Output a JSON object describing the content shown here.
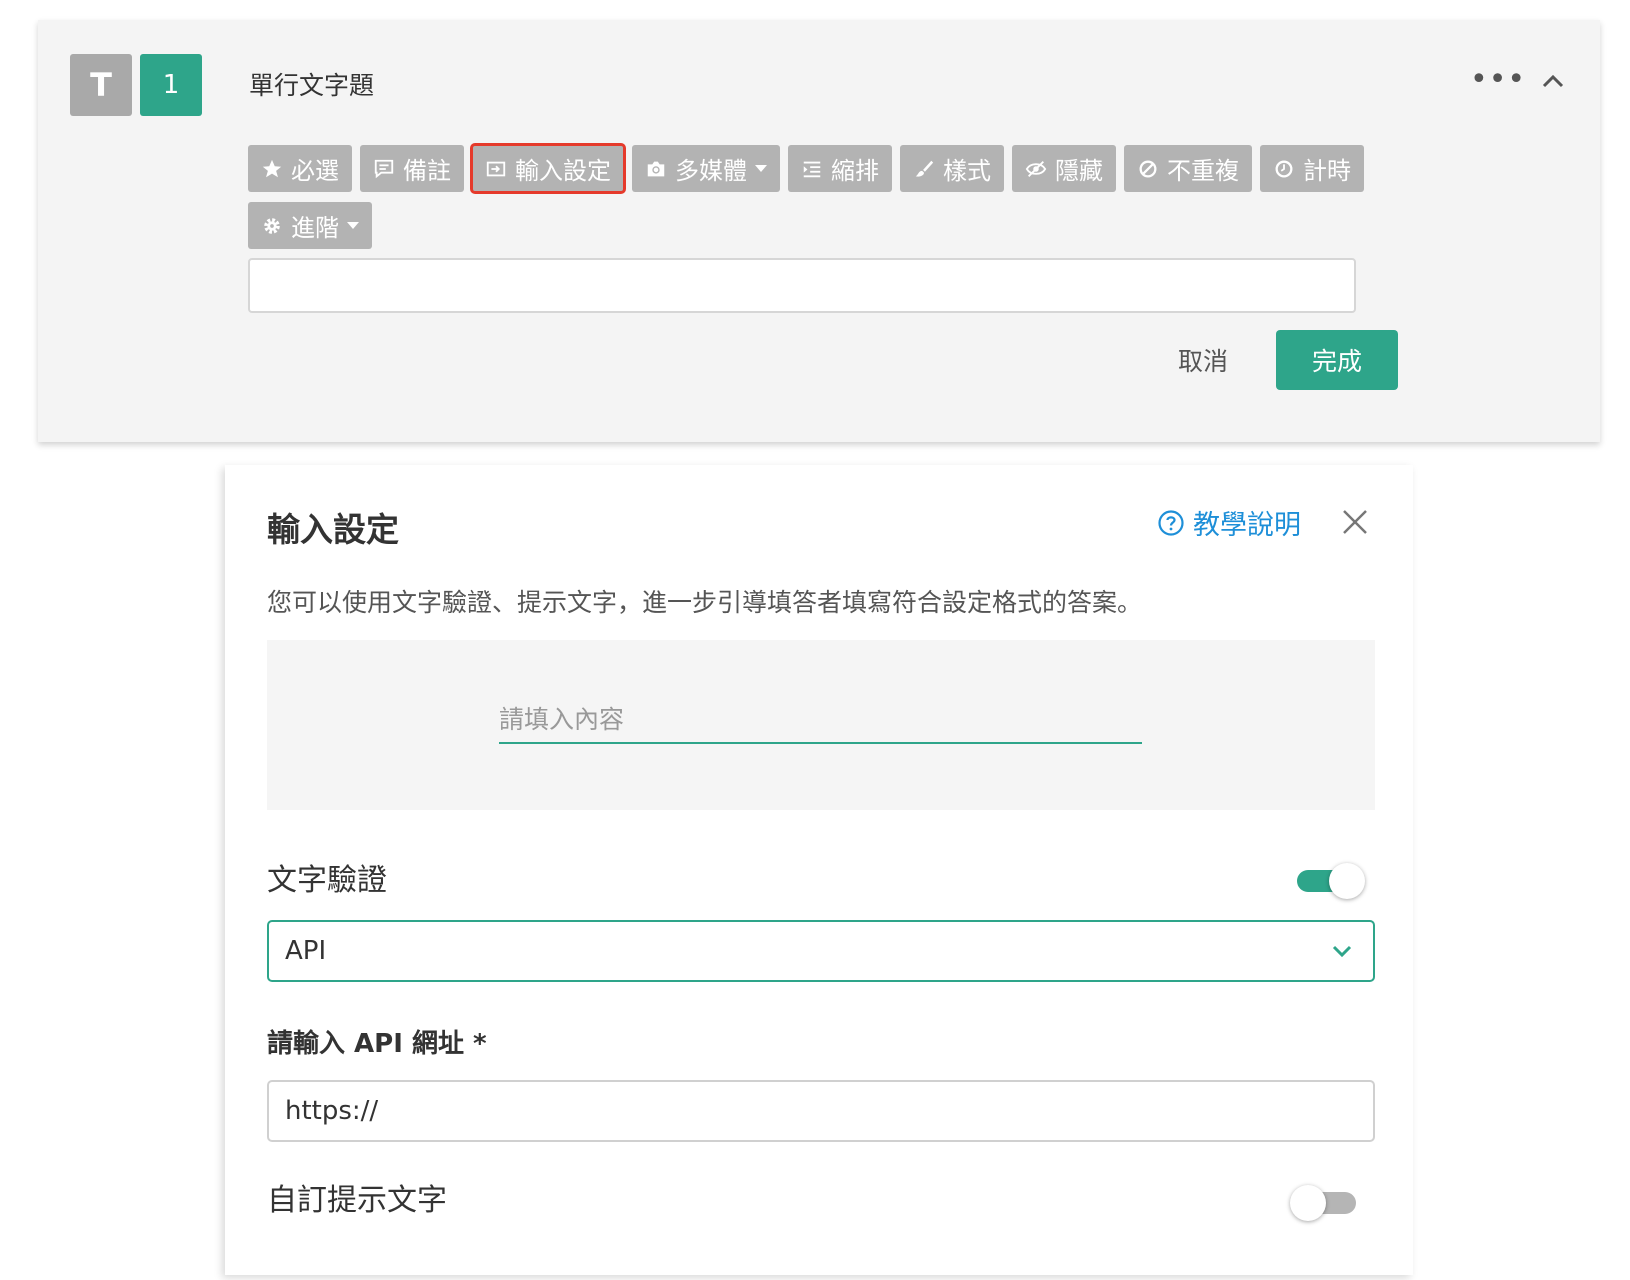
{
  "question": {
    "type_badge": "T",
    "number": "1",
    "title": "單行文字題",
    "more_label": "•••"
  },
  "toolbar": {
    "buttons": [
      {
        "label": "必選",
        "icon": "star-icon"
      },
      {
        "label": "備註",
        "icon": "comment-icon"
      },
      {
        "label": "輸入設定",
        "icon": "input-icon",
        "selected": true
      },
      {
        "label": "多媒體",
        "icon": "camera-icon",
        "dropdown": true
      },
      {
        "label": "縮排",
        "icon": "indent-icon"
      },
      {
        "label": "樣式",
        "icon": "brush-icon"
      },
      {
        "label": "隱藏",
        "icon": "eye-slash-icon"
      },
      {
        "label": "不重複",
        "icon": "ban-icon"
      },
      {
        "label": "計時",
        "icon": "clock-icon"
      },
      {
        "label": "進階",
        "icon": "gear-icon",
        "dropdown": true
      }
    ]
  },
  "actions": {
    "cancel_label": "取消",
    "done_label": "完成"
  },
  "panel": {
    "title": "輸入設定",
    "help_label": "教學說明",
    "description": "您可以使用文字驗證、提示文字，進一步引導填答者填寫符合設定格式的答案。",
    "preview_placeholder": "請填入內容",
    "validation_label": "文字驗證",
    "validation_enabled": true,
    "validation_type": "API",
    "api_label": "請輸入 API 網址 *",
    "api_value": "https://",
    "custom_hint_label": "自訂提示文字",
    "custom_hint_enabled": false
  },
  "colors": {
    "accent": "#2ea58a",
    "selected_outline": "#e53a2b",
    "link": "#1e8fd8",
    "toolbar_button": "#b3b3b3"
  }
}
